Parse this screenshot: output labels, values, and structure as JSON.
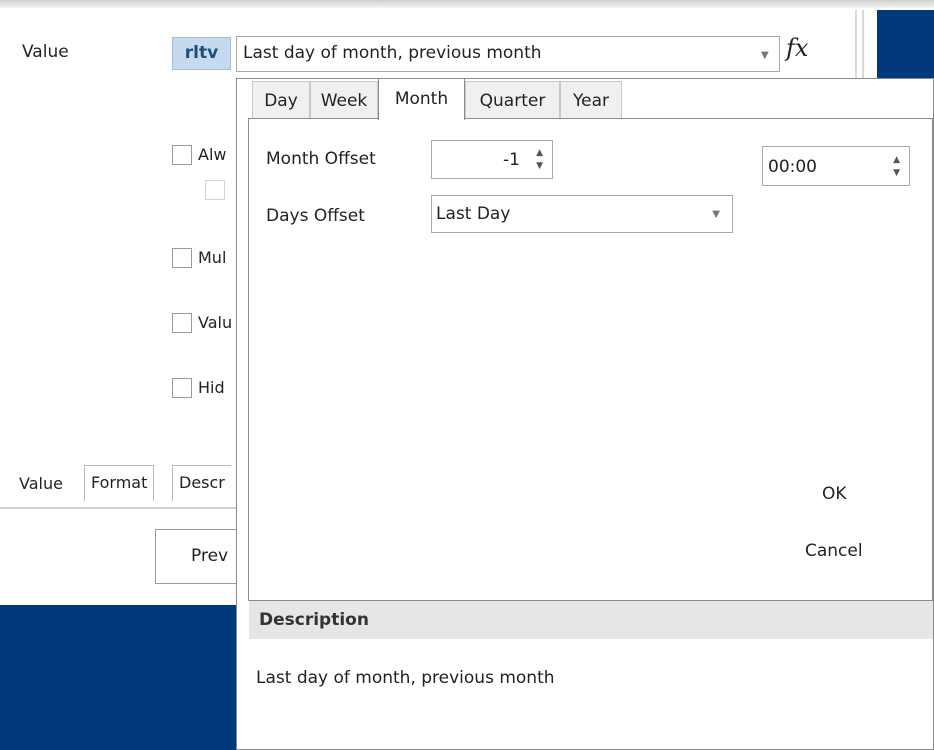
{
  "form": {
    "value_label": "Value",
    "rltv_badge": "rltv",
    "value_combo": "Last day of month, previous month",
    "fx_label": "fx",
    "checkboxes": [
      "Alw",
      "Mul",
      "Valu",
      "Hid"
    ],
    "tabs": [
      "Value",
      "Format",
      "Descr"
    ],
    "preview_button": "Prev"
  },
  "popup": {
    "tabs": [
      "Day",
      "Week",
      "Month",
      "Quarter",
      "Year"
    ],
    "active_tab": "Month",
    "month_offset_label": "Month Offset",
    "month_offset_value": "-1",
    "days_offset_label": "Days Offset",
    "days_offset_value": "Last Day",
    "time_value": "00:00",
    "ok_button": "OK",
    "cancel_button": "Cancel",
    "description_header": "Description",
    "description_text": "Last day of month, previous month"
  },
  "colors": {
    "accent_blue": "#003a7d",
    "badge_bg": "#c5d9ef"
  }
}
